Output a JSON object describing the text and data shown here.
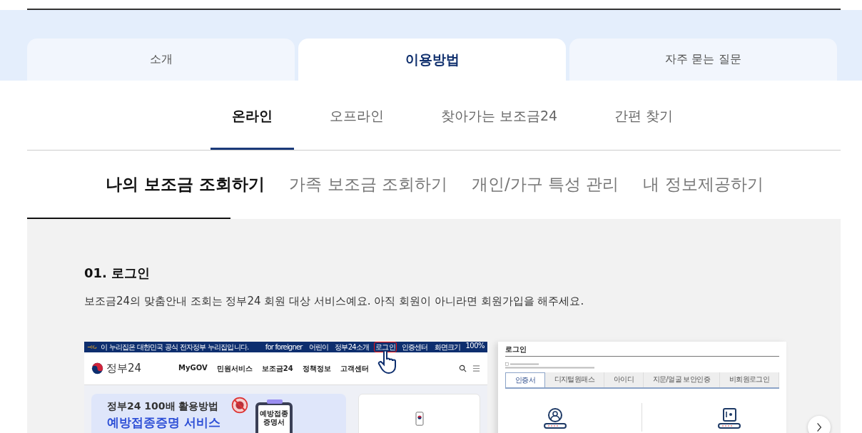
{
  "main_tabs": [
    {
      "label": "소개",
      "selected": false
    },
    {
      "label": "이용방법",
      "selected": true
    },
    {
      "label": "자주 묻는 질문",
      "selected": false
    }
  ],
  "method_tabs": [
    {
      "label": "온라인",
      "selected": true
    },
    {
      "label": "오프라인",
      "selected": false
    },
    {
      "label": "찾아가는 보조금24",
      "selected": false
    },
    {
      "label": "간편 찾기",
      "selected": false
    }
  ],
  "service_tabs": [
    {
      "label": "나의 보조금 조회하기",
      "selected": true
    },
    {
      "label": "가족 보조금 조회하기",
      "selected": false
    },
    {
      "label": "개인/가구 특성 관리",
      "selected": false
    },
    {
      "label": "내 정보제공하기",
      "selected": false
    }
  ],
  "step": {
    "title": "01. 로그인",
    "description": "보조금24의 맞춤안내 조회는 정부24 회원 대상 서비스예요. 아직 회원이 아니라면 회원가입을 해주세요."
  },
  "gov24_screenshot": {
    "notice": "이 누리집은 대한민국 공식 전자정부 누리집입니다.",
    "top_links": [
      {
        "label": "for foreigner",
        "highlighted": false
      },
      {
        "label": "어린이",
        "highlighted": false
      },
      {
        "label": "정부24소개",
        "highlighted": false
      },
      {
        "label": "로그인",
        "highlighted": true
      },
      {
        "label": "인증센터",
        "highlighted": false
      },
      {
        "label": "화면크기",
        "highlighted": false
      }
    ],
    "zoom": "100%",
    "logo": "정부24",
    "menu": [
      "MyGOV",
      "민원서비스",
      "보조금24",
      "정책정보",
      "고객센터"
    ],
    "banner_title": "정부24 100배 활용방법",
    "banner_subtitle": "예방접종증명 서비스",
    "clipboard_lines": [
      "예방접종",
      "증명서"
    ]
  },
  "login_screenshot": {
    "title": "로그인",
    "tabs": [
      {
        "label": "인증서",
        "selected": true
      },
      {
        "label": "디지털원패스",
        "selected": false
      },
      {
        "label": "아이디",
        "selected": false
      },
      {
        "label": "지문/얼굴 보안인증",
        "selected": false
      },
      {
        "label": "비회원로그인",
        "selected": false
      }
    ]
  }
}
